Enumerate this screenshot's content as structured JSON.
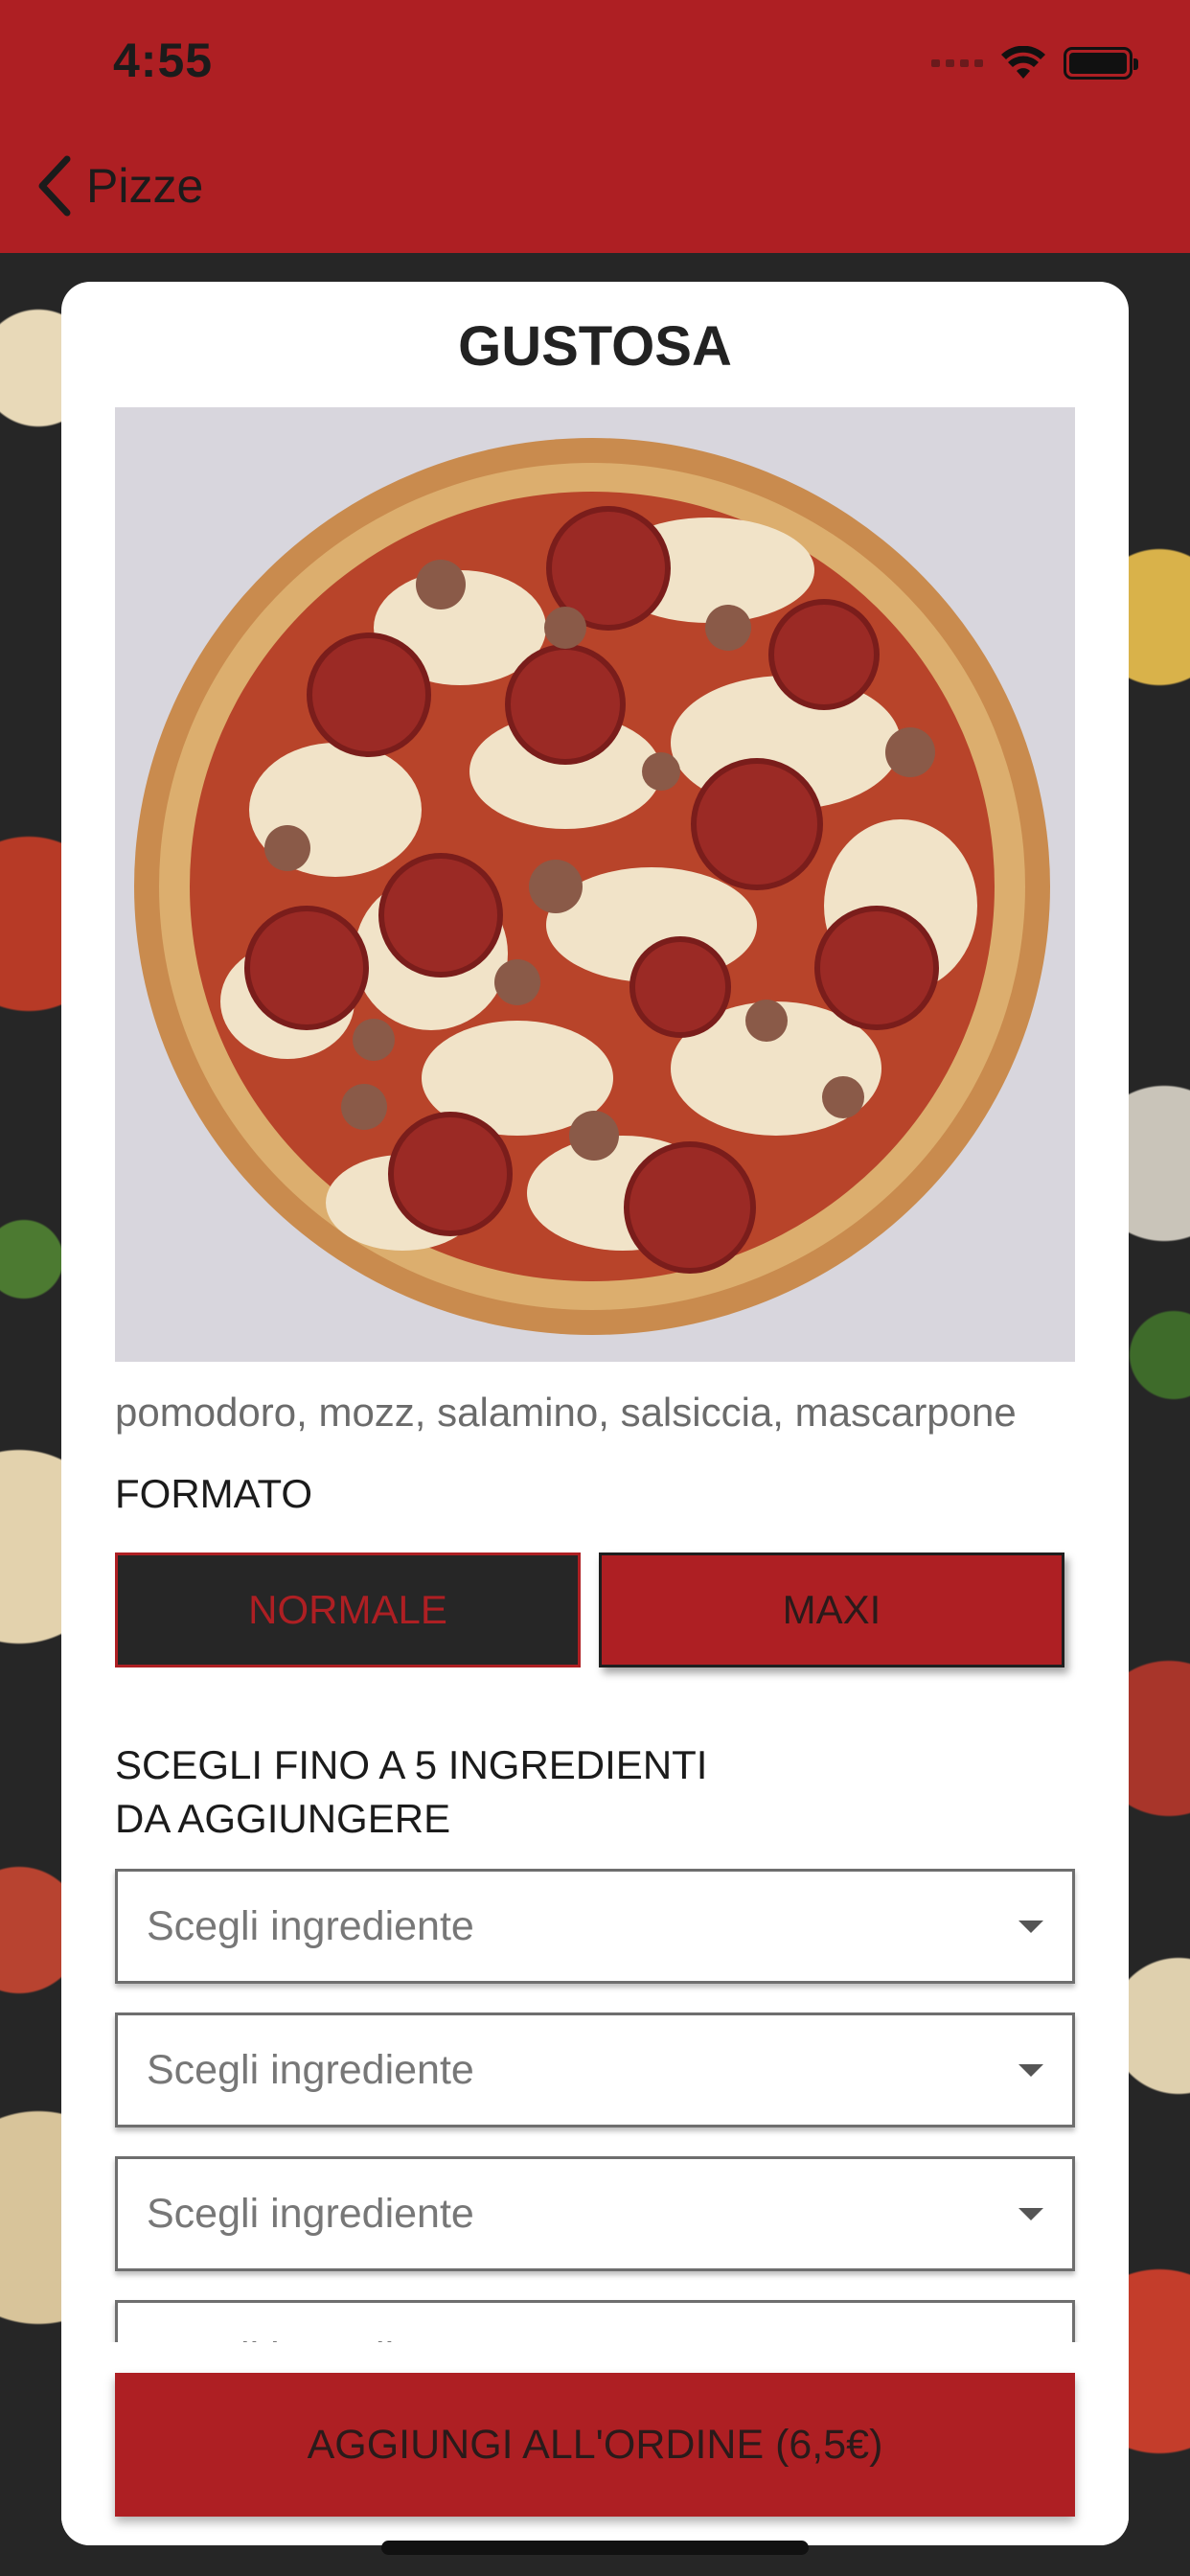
{
  "status_bar": {
    "time": "4:55",
    "icons": [
      "cellular-signal-icon",
      "wifi-icon",
      "battery-icon"
    ]
  },
  "nav": {
    "back_label": "Pizze",
    "back_icon": "chevron-left-icon",
    "bar_color": "#ae1f23"
  },
  "product": {
    "name": "GUSTOSA",
    "ingredients": "pomodoro, mozz, salamino, salsiccia, mascarpone"
  },
  "format": {
    "label": "FORMATO",
    "options": [
      {
        "label": "NORMALE",
        "selected": false
      },
      {
        "label": "MAXI",
        "selected": true
      }
    ]
  },
  "extras": {
    "label_line1": "SCEGLI FINO A 5 INGREDIENTI",
    "label_line2": "DA AGGIUNGERE",
    "selects": [
      {
        "placeholder": "Scegli ingrediente"
      },
      {
        "placeholder": "Scegli ingrediente"
      },
      {
        "placeholder": "Scegli ingrediente"
      },
      {
        "placeholder": "Scegli ingrediente"
      }
    ]
  },
  "cta": {
    "label": "AGGIUNGI ALL'ORDINE (6,5€)"
  },
  "colors": {
    "accent": "#ae1f23",
    "dark": "#262626"
  }
}
